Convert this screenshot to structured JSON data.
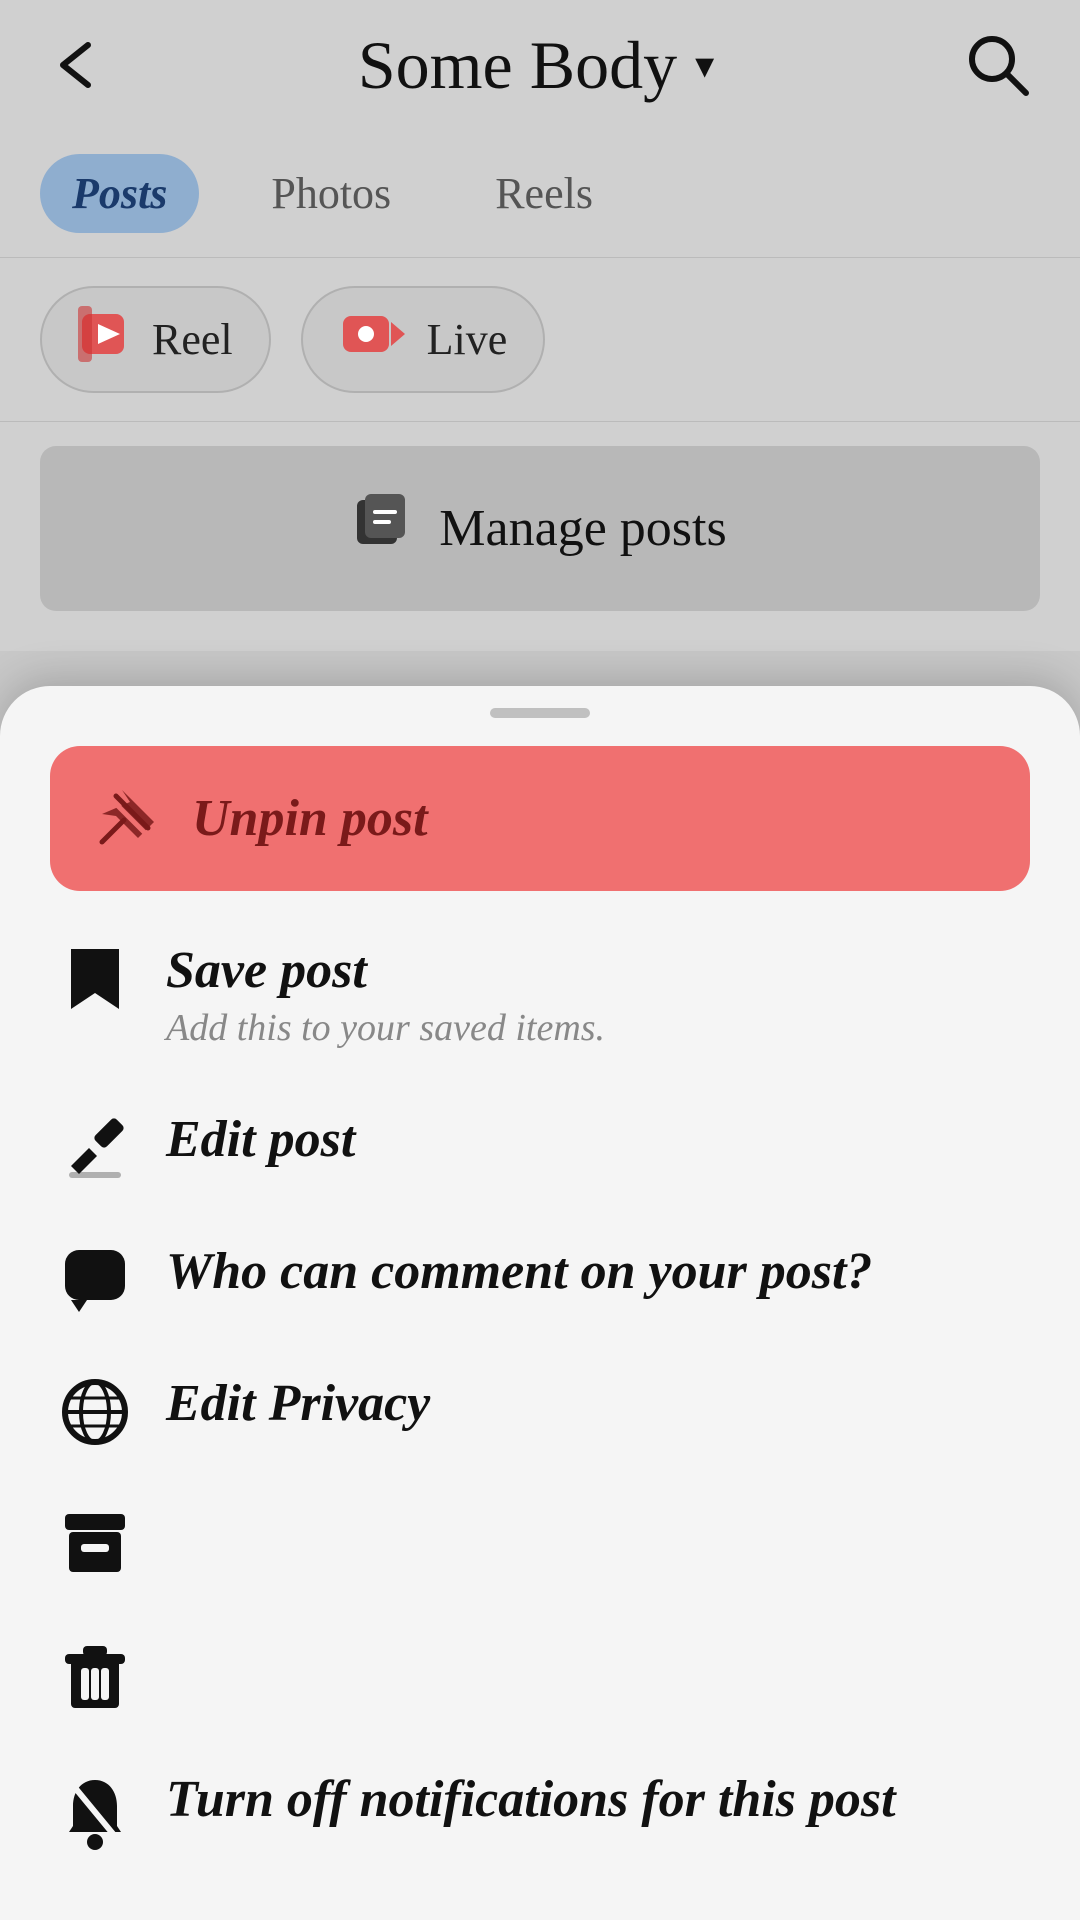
{
  "header": {
    "back_label": "←",
    "title": "Some Body",
    "dropdown_arrow": "▼",
    "search_label": "🔍"
  },
  "tabs": [
    {
      "id": "posts",
      "label": "Posts",
      "active": true
    },
    {
      "id": "photos",
      "label": "Photos",
      "active": false
    },
    {
      "id": "reels",
      "label": "Reels",
      "active": false
    }
  ],
  "action_buttons": [
    {
      "id": "reel",
      "label": "Reel"
    },
    {
      "id": "live",
      "label": "Live"
    }
  ],
  "manage_posts": {
    "label": "Manage posts"
  },
  "bottom_sheet": {
    "items": [
      {
        "id": "unpin",
        "label": "Unpin post",
        "sublabel": "",
        "icon": "unpin",
        "highlighted": true
      },
      {
        "id": "save",
        "label": "Save post",
        "sublabel": "Add this to your saved items.",
        "icon": "bookmark",
        "highlighted": false
      },
      {
        "id": "edit",
        "label": "Edit post",
        "sublabel": "",
        "icon": "pencil",
        "highlighted": false
      },
      {
        "id": "comment",
        "label": "Who can comment on your post?",
        "sublabel": "",
        "icon": "comment",
        "highlighted": false
      },
      {
        "id": "privacy",
        "label": "Edit Privacy",
        "sublabel": "",
        "icon": "globe",
        "highlighted": false
      },
      {
        "id": "archive",
        "label": "",
        "sublabel": "",
        "icon": "archive",
        "highlighted": false
      },
      {
        "id": "delete",
        "label": "",
        "sublabel": "",
        "icon": "trash",
        "highlighted": false
      },
      {
        "id": "notifications",
        "label": "Turn off notifications for this post",
        "sublabel": "",
        "icon": "bell-off",
        "highlighted": false
      }
    ]
  },
  "colors": {
    "accent_blue": "#8faecf",
    "unpin_bg": "#f07070",
    "unpin_text": "#7a1a1a"
  }
}
